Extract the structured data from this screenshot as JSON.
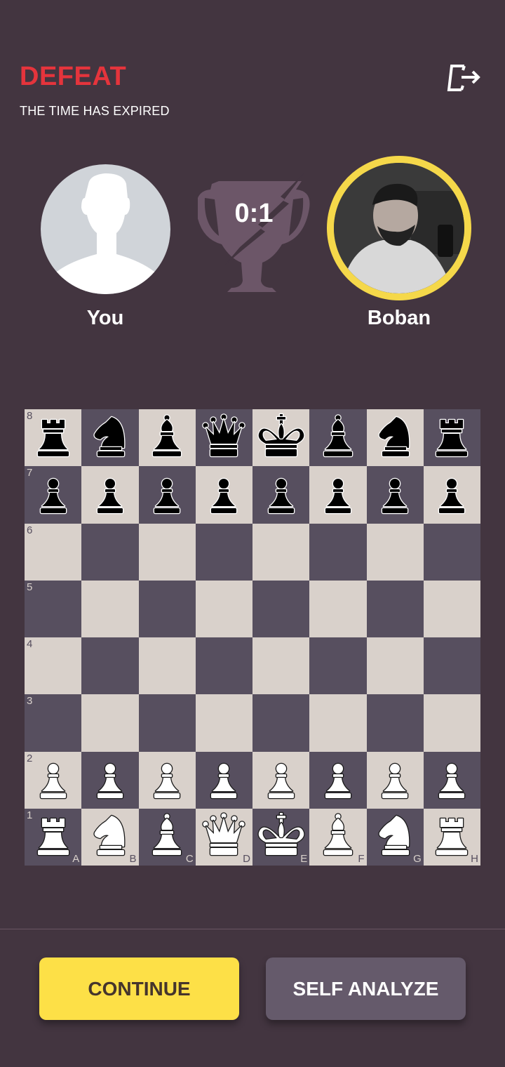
{
  "header": {
    "result": "DEFEAT",
    "reason": "THE TIME HAS EXPIRED",
    "exit_icon": "exit-icon"
  },
  "colors": {
    "background": "#433540",
    "defeat": "#e5343c",
    "winner_ring": "#f5d84a",
    "light_square": "#d9d1cb",
    "dark_square": "#574f5f",
    "continue_button": "#fde047",
    "analyze_button": "#655a6b"
  },
  "players": {
    "you": {
      "name": "You",
      "avatar": "default-avatar-silhouette"
    },
    "opponent": {
      "name": "Boban",
      "avatar": "photo",
      "winner": true
    }
  },
  "score": {
    "text": "0:1",
    "icon": "broken-trophy-icon"
  },
  "board": {
    "ranks": [
      "8",
      "7",
      "6",
      "5",
      "4",
      "3",
      "2",
      "1"
    ],
    "files": [
      "A",
      "B",
      "C",
      "D",
      "E",
      "F",
      "G",
      "H"
    ],
    "position": [
      [
        "br",
        "bn",
        "bb",
        "bq",
        "bk",
        "bb",
        "bn",
        "br"
      ],
      [
        "bp",
        "bp",
        "bp",
        "bp",
        "bp",
        "bp",
        "bp",
        "bp"
      ],
      [
        "",
        "",
        "",
        "",
        "",
        "",
        "",
        ""
      ],
      [
        "",
        "",
        "",
        "",
        "",
        "",
        "",
        ""
      ],
      [
        "",
        "",
        "",
        "",
        "",
        "",
        "",
        ""
      ],
      [
        "",
        "",
        "",
        "",
        "",
        "",
        "",
        ""
      ],
      [
        "wp",
        "wp",
        "wp",
        "wp",
        "wp",
        "wp",
        "wp",
        "wp"
      ],
      [
        "wr",
        "wn",
        "wb",
        "wq",
        "wk",
        "wb",
        "wn",
        "wr"
      ]
    ]
  },
  "actions": {
    "continue": "CONTINUE",
    "self_analyze": "SELF ANALYZE"
  }
}
